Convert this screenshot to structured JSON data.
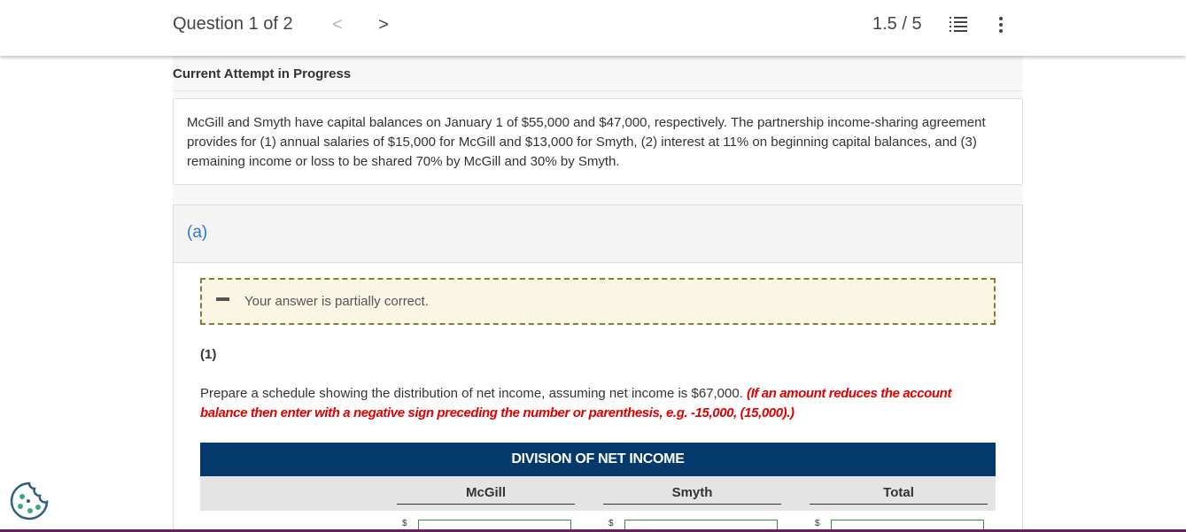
{
  "header": {
    "question_label": "Question 1 of 2",
    "prev_glyph": "<",
    "next_glyph": ">",
    "score": "1.5 / 5",
    "list_icon": "list-icon",
    "more_icon": "more-vertical-icon"
  },
  "attempt": {
    "label": "Current Attempt in Progress"
  },
  "problem": {
    "text": "McGill and Smyth have capital balances on January 1 of $55,000 and $47,000, respectively. The partnership income-sharing agreement provides for (1) annual salaries of $15,000 for McGill and $13,000 for Smyth, (2) interest at 11% on beginning capital balances, and (3) remaining income or loss to be shared 70% by McGill and 30% by Smyth."
  },
  "part": {
    "label": "(a)",
    "feedback_text": "Your answer is partially correct.",
    "sub_number": "(1)",
    "instruction_text": "Prepare a schedule showing the distribution of net income, assuming net income is $67,000. ",
    "instruction_note": "(If an amount reduces the account balance then enter with a negative sign preceding the number or parenthesis, e.g. -15,000, (15,000).)"
  },
  "table": {
    "title": "DIVISION OF NET INCOME",
    "columns": [
      "McGill",
      "Smyth",
      "Total"
    ],
    "currency_symbol": "$"
  },
  "colors": {
    "table_header": "#043a6b",
    "part_label": "#2a7bd6",
    "note_red": "#e00000",
    "cookie_green": "#3aa982"
  }
}
